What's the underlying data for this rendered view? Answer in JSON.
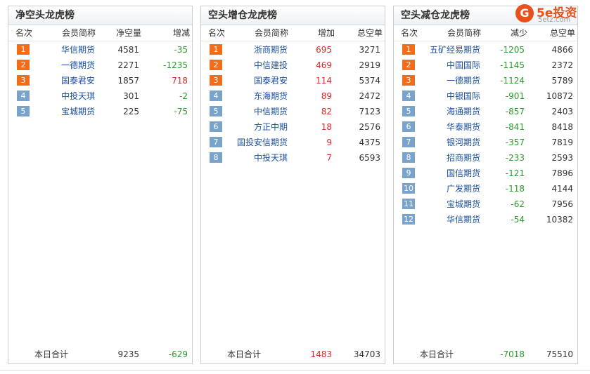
{
  "net_short": {
    "title": "净空头龙虎榜",
    "columns": [
      "名次",
      "会员简称",
      "净空量",
      "增减"
    ],
    "rows": [
      {
        "rank": "1",
        "name": "华信期货",
        "value": "4581",
        "change": "-35",
        "change_sign": "neg",
        "badge": "top"
      },
      {
        "rank": "2",
        "name": "一德期货",
        "value": "2271",
        "change": "-1235",
        "change_sign": "neg",
        "badge": "top"
      },
      {
        "rank": "3",
        "name": "国泰君安",
        "value": "1857",
        "change": "718",
        "change_sign": "pos",
        "badge": "top"
      },
      {
        "rank": "4",
        "name": "中投天琪",
        "value": "301",
        "change": "-2",
        "change_sign": "neg",
        "badge": "low"
      },
      {
        "rank": "5",
        "name": "宝城期货",
        "value": "225",
        "change": "-75",
        "change_sign": "neg",
        "badge": "low"
      }
    ],
    "total": {
      "label": "本日合计",
      "value": "9235",
      "change": "-629",
      "change_sign": "neg"
    }
  },
  "short_increase": {
    "title": "空头增仓龙虎榜",
    "columns": [
      "名次",
      "会员简称",
      "增加",
      "总空单"
    ],
    "rows": [
      {
        "rank": "1",
        "name": "浙商期货",
        "change": "695",
        "value": "3271",
        "badge": "top"
      },
      {
        "rank": "2",
        "name": "中信建投",
        "change": "469",
        "value": "2919",
        "badge": "top"
      },
      {
        "rank": "3",
        "name": "国泰君安",
        "change": "114",
        "value": "5374",
        "badge": "top"
      },
      {
        "rank": "4",
        "name": "东海期货",
        "change": "89",
        "value": "2472",
        "badge": "low"
      },
      {
        "rank": "5",
        "name": "中信期货",
        "change": "82",
        "value": "7123",
        "badge": "low"
      },
      {
        "rank": "6",
        "name": "方正中期",
        "change": "18",
        "value": "2576",
        "badge": "low"
      },
      {
        "rank": "7",
        "name": "国投安信期货",
        "change": "9",
        "value": "4375",
        "badge": "low"
      },
      {
        "rank": "8",
        "name": "中投天琪",
        "change": "7",
        "value": "6593",
        "badge": "low"
      }
    ],
    "total": {
      "label": "本日合计",
      "change": "1483",
      "value": "34703"
    }
  },
  "short_decrease": {
    "title": "空头减仓龙虎榜",
    "columns": [
      "名次",
      "会员简称",
      "减少",
      "总空单"
    ],
    "rows": [
      {
        "rank": "1",
        "name": "五矿经易期货",
        "change": "-1205",
        "value": "4866",
        "badge": "top"
      },
      {
        "rank": "2",
        "name": "中国国际",
        "change": "-1145",
        "value": "2372",
        "badge": "top"
      },
      {
        "rank": "3",
        "name": "一德期货",
        "change": "-1124",
        "value": "5789",
        "badge": "top"
      },
      {
        "rank": "4",
        "name": "中银国际",
        "change": "-901",
        "value": "10872",
        "badge": "low"
      },
      {
        "rank": "5",
        "name": "海通期货",
        "change": "-857",
        "value": "2403",
        "badge": "low"
      },
      {
        "rank": "6",
        "name": "华泰期货",
        "change": "-841",
        "value": "8418",
        "badge": "low"
      },
      {
        "rank": "7",
        "name": "银河期货",
        "change": "-357",
        "value": "7819",
        "badge": "low"
      },
      {
        "rank": "8",
        "name": "招商期货",
        "change": "-233",
        "value": "2593",
        "badge": "low"
      },
      {
        "rank": "9",
        "name": "国信期货",
        "change": "-121",
        "value": "7896",
        "badge": "low"
      },
      {
        "rank": "10",
        "name": "广发期货",
        "change": "-118",
        "value": "4144",
        "badge": "low"
      },
      {
        "rank": "11",
        "name": "宝城期货",
        "change": "-62",
        "value": "7956",
        "badge": "low"
      },
      {
        "rank": "12",
        "name": "华信期货",
        "change": "-54",
        "value": "10382",
        "badge": "low"
      }
    ],
    "total": {
      "label": "本日合计",
      "change": "-7018",
      "value": "75510"
    }
  },
  "logo": {
    "mark": "G",
    "brand": "5e投资",
    "sub": "5etz.com"
  },
  "colors": {
    "top_badge": "#f26c1a",
    "low_badge": "#7aa3cc",
    "negative": "#2c9a2c",
    "positive": "#d52b2b",
    "name": "#1a4f9c"
  }
}
